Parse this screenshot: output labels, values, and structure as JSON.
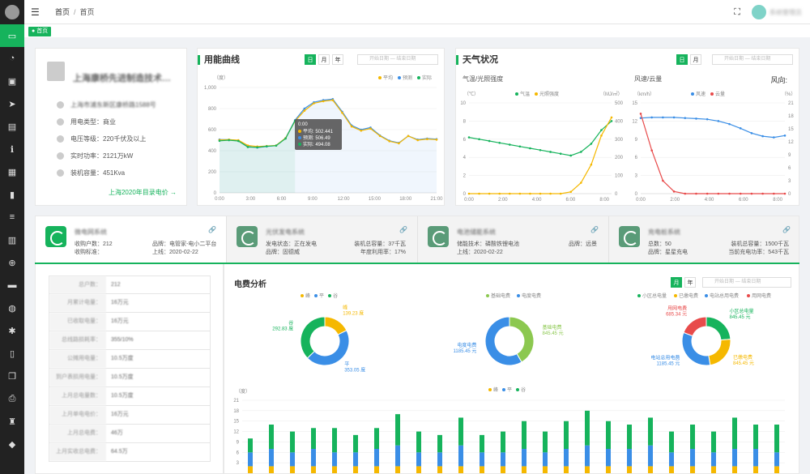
{
  "topbar": {
    "breadcrumb": [
      "首页",
      "首页"
    ],
    "user_name": "系统管理员"
  },
  "tabs": [
    {
      "label": "首页"
    }
  ],
  "sidebar": {
    "items": [
      {
        "icon": "monitor-icon",
        "active": true
      },
      {
        "icon": "dashboard-icon"
      },
      {
        "icon": "save-icon"
      },
      {
        "icon": "send-icon"
      },
      {
        "icon": "inbox-icon"
      },
      {
        "icon": "info-icon"
      },
      {
        "icon": "grid-icon"
      },
      {
        "icon": "bar-chart-icon"
      },
      {
        "icon": "list-icon"
      },
      {
        "icon": "table-icon"
      },
      {
        "icon": "plus-circle-icon"
      },
      {
        "icon": "film-icon"
      },
      {
        "icon": "globe-icon"
      },
      {
        "icon": "bug-icon"
      },
      {
        "icon": "mobile-icon"
      },
      {
        "icon": "copy-icon"
      },
      {
        "icon": "print-icon"
      },
      {
        "icon": "shirt-icon"
      },
      {
        "icon": "tag-icon"
      }
    ]
  },
  "company": {
    "name": "上海康桥先进制造技术…",
    "address": "上海市浦东新区康桥路1588号",
    "category_label": "用电类型：",
    "category": "商业",
    "voltage_label": "电压等级：",
    "voltage": "220千伏及以上",
    "power_label": "实时功率：",
    "power": "2121万kW",
    "capacity_label": "装机容量：",
    "capacity": "451Kva",
    "link": "上海2020年目录电价 →"
  },
  "usage": {
    "title": "用能曲线",
    "buttons": [
      "日",
      "月",
      "年"
    ],
    "active": "日",
    "date_start": "开始日期",
    "date_to": "—",
    "date_end": "结束日期",
    "legend": [
      "平均",
      "预测",
      "实际"
    ],
    "tooltip": {
      "time": "0:00",
      "avg": "平均: 502.441",
      "pred": "预测: 506.49",
      "real": "实际: 494.08"
    }
  },
  "weather": {
    "title": "天气状况",
    "buttons": [
      "日",
      "月"
    ],
    "active": "日",
    "date_start": "开始日期",
    "date_to": "—",
    "date_end": "结束日期",
    "left_sub": "气温/光照强度",
    "right_sub": "风速/云量",
    "wind_dir": "风向:",
    "left_legend": [
      "气温",
      "光照强度"
    ],
    "right_legend": [
      "风速",
      "云量"
    ]
  },
  "systems": [
    {
      "name": "微电网系统",
      "l1": "收购户数：212",
      "l2": "收购标准：",
      "r1": "品牌：电管家-电小二平台",
      "r2": "上线：2020-02-22"
    },
    {
      "name": "光伏发电系统",
      "l1": "发电状态：正在发电",
      "l2": "品牌：固德威",
      "r1": "装机总容量：37千瓦",
      "r2": "年度利用率：17%"
    },
    {
      "name": "电池储能系统",
      "l1": "储能技术：磷酸铁锂电池",
      "l2": "上线：2020-02-22",
      "r1": "品牌：远景",
      "r2": ""
    },
    {
      "name": "充电桩系统",
      "l1": "总数：50",
      "l2": "品牌：星星充电",
      "r1": "装机总容量：1500千瓦",
      "r2": "当前充电功率：543千瓦"
    }
  ],
  "detail_rows": [
    {
      "k": "总户数：",
      "v": "212"
    },
    {
      "k": "月累计电量：",
      "v": "16万元"
    },
    {
      "k": "已收取电量：",
      "v": "16万元"
    },
    {
      "k": "总线路损耗率：",
      "v": "355/10%"
    },
    {
      "k": "公摊用电量：",
      "v": "10.5万度"
    },
    {
      "k": "到户表损用电量：",
      "v": "10.5万度"
    },
    {
      "k": "上月总电量数：",
      "v": "10.5万度"
    },
    {
      "k": "上月单电电价：",
      "v": "16万元"
    },
    {
      "k": "上月总电费：",
      "v": "46万"
    },
    {
      "k": "上月实收总电费：",
      "v": "64.5万"
    }
  ],
  "fee": {
    "title": "电费分析",
    "buttons": [
      "月",
      "年"
    ],
    "active": "月",
    "date_start": "开始日期",
    "date_to": "—",
    "date_end": "结束日期",
    "donut1_legend": [
      "峰",
      "平",
      "谷"
    ],
    "donut2_legend": [
      "基础电费",
      "电度电费"
    ],
    "donut3_legend": [
      "小区总电量",
      "已缴电费",
      "电站总用电费",
      "用网电费"
    ],
    "bar_legend": [
      "峰",
      "平",
      "谷"
    ],
    "bar_unit": "（度）"
  },
  "chart_data": [
    {
      "type": "line",
      "title": "用能曲线",
      "ylabel": "（度）",
      "ylim": [
        0,
        1000
      ],
      "yticks": [
        "0",
        "200",
        "400",
        "600",
        "800",
        "1,000"
      ],
      "xticks": [
        "0:00",
        "3:00",
        "6:00",
        "9:00",
        "12:00",
        "15:00",
        "18:00",
        "21:00"
      ],
      "series": [
        {
          "name": "平均",
          "color": "#f5b800",
          "values": [
            502,
            505,
            500,
            450,
            440,
            445,
            450,
            520,
            680,
            780,
            850,
            870,
            880,
            760,
            630,
            590,
            610,
            540,
            490,
            470,
            540,
            500,
            510,
            505
          ]
        },
        {
          "name": "预测",
          "color": "#3a8ee6",
          "values": [
            506,
            505,
            498,
            440,
            430,
            440,
            450,
            520,
            690,
            800,
            860,
            880,
            890,
            770,
            640,
            600,
            620,
            545,
            495,
            475,
            540,
            505,
            515,
            510
          ]
        },
        {
          "name": "实际",
          "color": "#16b35c",
          "values": [
            494,
            500,
            492,
            435,
            432,
            442,
            448,
            515,
            685
          ]
        }
      ]
    },
    {
      "type": "line",
      "title": "气温/光照强度",
      "ylabel_left": "（℃）",
      "ylabel_right": "（MJ/㎡）",
      "ylim_left": [
        0,
        10
      ],
      "ylim_right": [
        0,
        500
      ],
      "yticks_left": [
        "0",
        "2",
        "4",
        "6",
        "8",
        "10"
      ],
      "yticks_right": [
        "0",
        "100",
        "200",
        "300",
        "400",
        "500"
      ],
      "xticks": [
        "0:00",
        "2:00",
        "4:00",
        "6:00",
        "8:00"
      ],
      "series": [
        {
          "name": "气温",
          "color": "#16b35c",
          "axis": "left",
          "values": [
            6.2,
            6.0,
            5.8,
            5.6,
            5.4,
            5.2,
            5.0,
            4.8,
            4.6,
            4.4,
            4.2,
            4.6,
            5.5,
            7.0,
            8.0
          ]
        },
        {
          "name": "光照强度",
          "color": "#f5b800",
          "axis": "right",
          "values": [
            0,
            0,
            0,
            0,
            0,
            0,
            0,
            0,
            0,
            0,
            10,
            60,
            160,
            320,
            420
          ]
        }
      ]
    },
    {
      "type": "line",
      "title": "风速/云量",
      "ylabel_left": "（km/h）",
      "ylabel_right": "（%）",
      "ylim_left": [
        0,
        15
      ],
      "ylim_right": [
        0,
        21
      ],
      "yticks_left": [
        "0",
        "3",
        "6",
        "9",
        "12",
        "15"
      ],
      "yticks_right": [
        "0",
        "3",
        "6",
        "9",
        "12",
        "15",
        "18",
        "21"
      ],
      "xticks": [
        "0:00",
        "2:00",
        "4:00",
        "6:00",
        "8:00"
      ],
      "series": [
        {
          "name": "风速",
          "color": "#3a8ee6",
          "axis": "left",
          "values": [
            12.5,
            12.6,
            12.6,
            12.6,
            12.5,
            12.4,
            12.3,
            12.0,
            11.5,
            10.8,
            10.0,
            9.5,
            9.3,
            9.6
          ]
        },
        {
          "name": "云量",
          "color": "#e84b4b",
          "axis": "right",
          "values": [
            18.5,
            10,
            3,
            0.5,
            0,
            0,
            0,
            0,
            0,
            0,
            0,
            0,
            0,
            0
          ]
        }
      ]
    },
    {
      "type": "pie",
      "labels": [
        "峰",
        "平",
        "谷"
      ],
      "values": [
        139.23,
        353.05,
        292.83
      ],
      "colors": [
        "#f5b800",
        "#3a8ee6",
        "#16b35c"
      ],
      "value_labels": [
        "139.23 度",
        "353.05 度",
        "292.83 度"
      ]
    },
    {
      "type": "pie",
      "labels": [
        "基础电费",
        "电度电费"
      ],
      "values": [
        845.45,
        1185.45
      ],
      "colors": [
        "#8cc850",
        "#3a8ee6"
      ],
      "value_labels": [
        "845.45 元",
        "1185.45 元"
      ]
    },
    {
      "type": "pie",
      "labels": [
        "小区总电量",
        "已缴电费",
        "电站总用电费",
        "用网电费"
      ],
      "values": [
        845.45,
        845.45,
        1185.45,
        685.34
      ],
      "colors": [
        "#16b35c",
        "#f5b800",
        "#3a8ee6",
        "#e84b4b"
      ],
      "value_labels": [
        "845.45 元",
        "845.45 元",
        "1185.45 元",
        "685.34 元"
      ]
    },
    {
      "type": "bar",
      "stacked": true,
      "ylim": [
        0,
        21
      ],
      "yticks": [
        "3",
        "6",
        "9",
        "12",
        "15",
        "18",
        "21"
      ],
      "series": [
        {
          "name": "峰",
          "color": "#f5b800",
          "values": [
            2,
            2,
            2,
            2,
            2,
            2,
            2,
            2,
            2,
            2,
            2,
            2,
            2,
            2,
            2,
            2,
            2,
            2,
            2,
            2,
            2,
            2,
            2,
            2,
            2,
            2
          ]
        },
        {
          "name": "平",
          "color": "#3a8ee6",
          "values": [
            4,
            5,
            4,
            5,
            4,
            4,
            5,
            6,
            4,
            4,
            6,
            4,
            4,
            5,
            4,
            5,
            6,
            5,
            5,
            6,
            4,
            5,
            4,
            5,
            5,
            4
          ]
        },
        {
          "name": "谷",
          "color": "#16b35c",
          "values": [
            4,
            7,
            6,
            6,
            7,
            5,
            6,
            9,
            6,
            5,
            8,
            5,
            6,
            8,
            6,
            8,
            10,
            8,
            7,
            8,
            6,
            7,
            6,
            9,
            7,
            8
          ]
        }
      ]
    }
  ]
}
